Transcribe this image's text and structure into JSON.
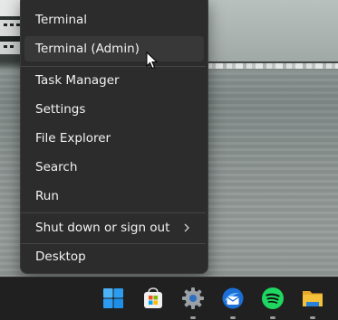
{
  "context_menu": {
    "items": [
      {
        "label": "Terminal"
      },
      {
        "label": "Terminal (Admin)"
      },
      {
        "label": "Task Manager"
      },
      {
        "label": "Settings"
      },
      {
        "label": "File Explorer"
      },
      {
        "label": "Search"
      },
      {
        "label": "Run"
      },
      {
        "label": "Shut down or sign out",
        "icon": "chevron-right-icon"
      },
      {
        "label": "Desktop"
      }
    ],
    "hovered_item": "Terminal (Admin)",
    "background_color": "#2c2c2c"
  },
  "taskbar": {
    "icons": [
      {
        "name": "windows-start-icon",
        "running": false
      },
      {
        "name": "microsoft-store-icon",
        "running": false
      },
      {
        "name": "settings-gear-icon",
        "running": true
      },
      {
        "name": "thunderbird-icon",
        "running": true
      },
      {
        "name": "spotify-icon",
        "running": true
      },
      {
        "name": "file-explorer-folder-icon",
        "running": true
      }
    ],
    "background_color": "#202020"
  },
  "colors": {
    "windows_blue": "#1e8fe8",
    "spotify_green": "#1ed760",
    "folder_yellow": "#f3c13a"
  }
}
